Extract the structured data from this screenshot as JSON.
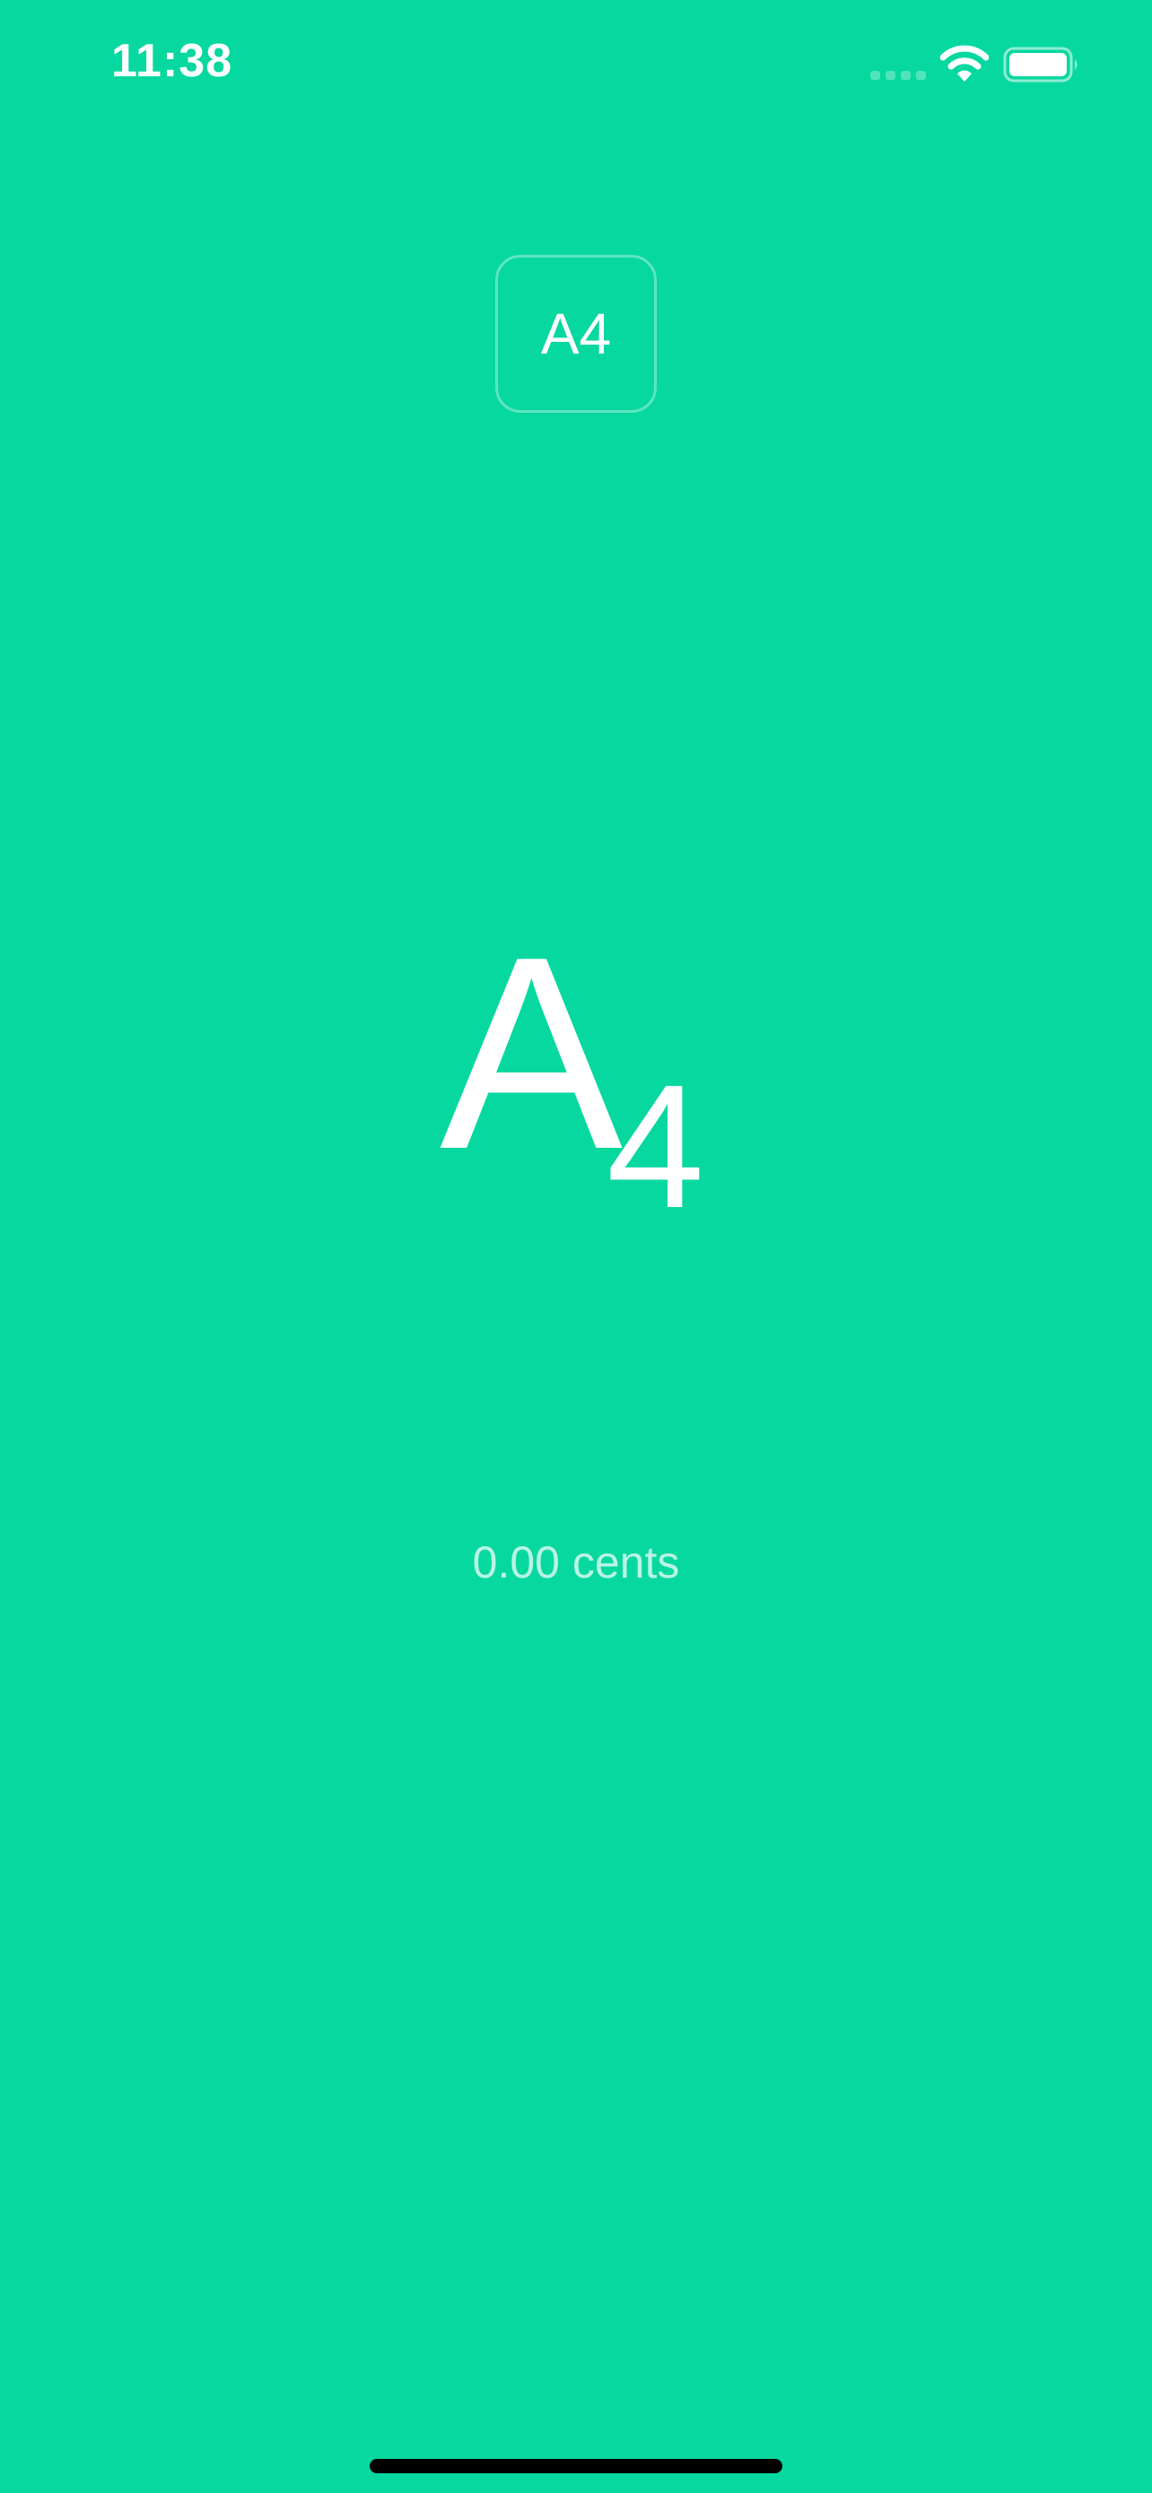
{
  "status_bar": {
    "time": "11:38",
    "icons": [
      "signal-icon",
      "wifi-icon",
      "battery-icon"
    ]
  },
  "reference_note": {
    "label": "A4"
  },
  "detected_note": {
    "letter": "A",
    "octave": "4"
  },
  "cents": {
    "text": "0.00 cents"
  },
  "colors": {
    "background": "#07d89f",
    "text": "#ffffff"
  }
}
